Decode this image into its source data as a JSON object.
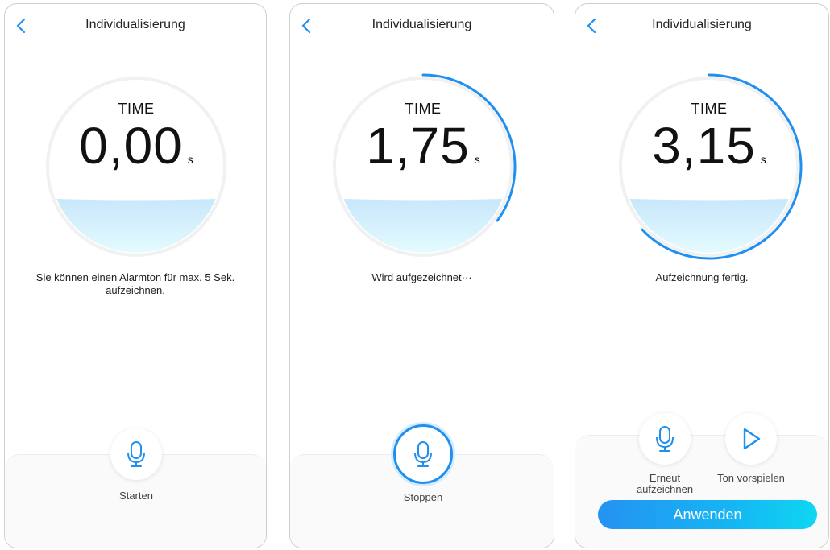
{
  "colors": {
    "accent": "#1f8ff0",
    "ring_bg": "#f1f1f1",
    "wave_top": "#c8e7fb",
    "wave_bottom": "#e4fbff"
  },
  "screens": [
    {
      "title": "Individualisierung",
      "time_label": "TIME",
      "time_value": "0,00",
      "time_unit": "s",
      "progress": 0,
      "status": "Sie können einen Alarmton für max. 5 Sek. aufzeichnen.",
      "buttons": [
        {
          "label": "Starten",
          "icon": "microphone-icon"
        }
      ]
    },
    {
      "title": "Individualisierung",
      "time_label": "TIME",
      "time_value": "1,75",
      "time_unit": "s",
      "progress": 0.35,
      "status": "Wird aufgezeichnet···",
      "buttons": [
        {
          "label": "Stoppen",
          "icon": "microphone-icon"
        }
      ]
    },
    {
      "title": "Individualisierung",
      "time_label": "TIME",
      "time_value": "3,15",
      "time_unit": "s",
      "progress": 0.63,
      "status": "Aufzeichnung fertig.",
      "buttons": [
        {
          "label": "Erneut aufzeichnen",
          "icon": "microphone-icon"
        },
        {
          "label": "Ton vorspielen",
          "icon": "play-icon"
        }
      ],
      "apply_label": "Anwenden"
    }
  ]
}
